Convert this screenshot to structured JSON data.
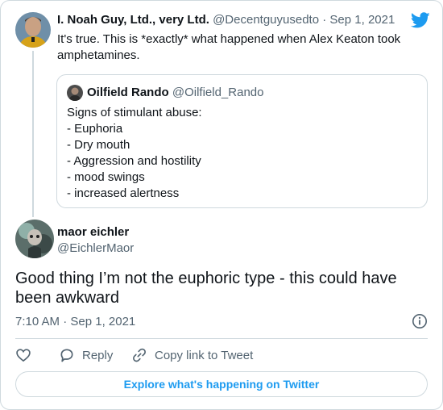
{
  "parent_tweet": {
    "author_name": "I. Noah Guy, Ltd., very Ltd.",
    "handle": "@Decentguyusedto",
    "separator": "·",
    "date": "Sep 1, 2021",
    "text": "It's true. This is *exactly* what happened when Alex Keaton took amphetamines."
  },
  "quoted_tweet": {
    "author_name": "Oilfield Rando",
    "handle": "@Oilfield_Rando",
    "lines": [
      "Signs of stimulant abuse:",
      "- Euphoria",
      "- Dry mouth",
      "- Aggression and hostility",
      "- mood swings",
      "- increased alertness"
    ]
  },
  "main_tweet": {
    "author_name": "maor eichler",
    "handle": "@EichlerMaor",
    "text": "Good thing I’m not the euphoric type - this could have been awkward",
    "timestamp": "7:10 AM · Sep 1, 2021"
  },
  "actions": {
    "reply_label": "Reply",
    "copy_link_label": "Copy link to Tweet"
  },
  "explore_label": "Explore what's happening on Twitter",
  "colors": {
    "accent": "#1d9bf0",
    "muted_text": "#536471",
    "border": "#cfd9de",
    "text": "#0f1419"
  },
  "icons": {
    "brand": "twitter-bird-icon",
    "info": "info-icon",
    "like": "heart-icon",
    "reply": "speech-bubble-icon",
    "copy_link": "link-icon"
  }
}
